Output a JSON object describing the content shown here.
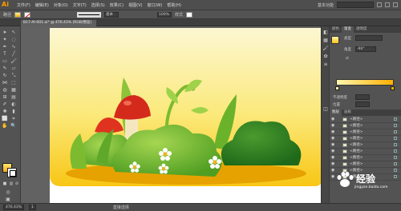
{
  "app": {
    "logo": "Ai"
  },
  "menus": [
    "文件(F)",
    "编辑(E)",
    "对象(O)",
    "文字(T)",
    "选择(S)",
    "效果(C)",
    "视图(V)",
    "窗口(W)",
    "帮助(H)"
  ],
  "topbar_right": {
    "workspace": "基本功能"
  },
  "control_bar": {
    "left_label": "路径",
    "stroke_style": "基本",
    "opacity": "100%",
    "style_label": "样式"
  },
  "document": {
    "tab_label": "B17-AI-001.ai* @ 476.43% (RGB/预览)"
  },
  "status_bar": {
    "zoom": "476.43%",
    "page": "1",
    "tool": "直接选择"
  },
  "panel": {
    "tabs": [
      "颜色",
      "渐变",
      "透明度"
    ],
    "type_label": "类型",
    "angle_label": "角度",
    "angle_value": "-90°",
    "opacity_label": "不透明度",
    "location_label": "位置"
  },
  "layers": {
    "tabs": [
      "图层",
      "画板"
    ],
    "rows": [
      "<路径>",
      "<路径>",
      "<路径>",
      "<路径>",
      "<路径>",
      "<路径>",
      "<路径>",
      "<路径>",
      "<路径>",
      "<路径>"
    ]
  },
  "watermark": {
    "text": "经验",
    "site": "jingyan.baidu.com"
  },
  "colors": {
    "sky_top": "#fbf5c6",
    "sky_bottom": "#f7c316",
    "ground": "#e8a100",
    "bush": "#5fae28",
    "mushroom": "#d4261b"
  }
}
